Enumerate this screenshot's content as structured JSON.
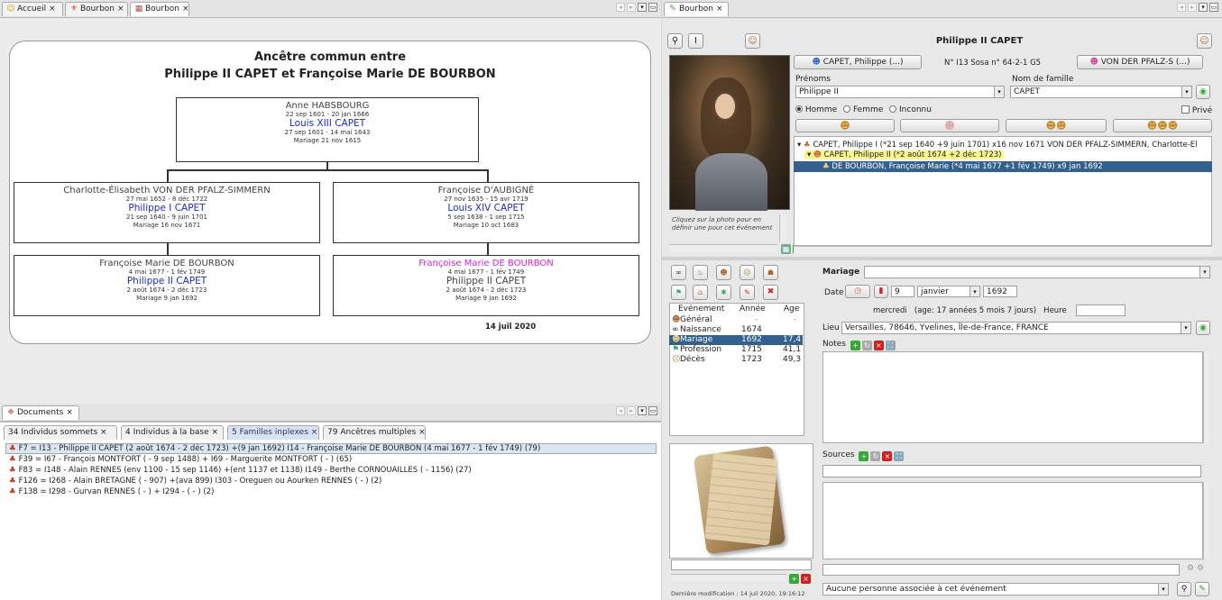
{
  "left_tabs": [
    {
      "label": "Accueil",
      "icon": "☺"
    },
    {
      "label": "Bourbon",
      "icon": "⚜"
    },
    {
      "label": "Bourbon",
      "icon": "▦"
    }
  ],
  "tree": {
    "title_line1": "Ancêtre commun entre",
    "title_line2": "Philippe II CAPET et Françoise Marie DE BOURBON",
    "top": {
      "name": "Anne HABSBOURG",
      "dates": "22 sep 1601 - 20 jan 1666",
      "spouse": "Louis XIII CAPET",
      "spouse_dates": "27 sep 1601 - 14 mai 1643",
      "marriage": "Mariage 21 nov 1615"
    },
    "mid_left": {
      "name": "Charlotte-Élisabeth VON DER PFALZ-SIMMERN",
      "dates": "27 mai 1652 - 8 déc 1722",
      "spouse": "Philippe I CAPET",
      "spouse_dates": "21 sep 1640 - 9 juin 1701",
      "marriage": "Mariage 16 nov 1671"
    },
    "mid_right": {
      "name": "Françoise D'AUBIGNÉ",
      "dates": "27 nov 1635 - 15 avr 1719",
      "spouse": "Louis XIV CAPET",
      "spouse_dates": "5 sep 1638 - 1 sep 1715",
      "marriage": "Mariage 10 oct 1683"
    },
    "bot_left": {
      "name": "Françoise Marie DE BOURBON",
      "dates": "4 mai 1677 - 1 fév 1749",
      "spouse": "Philippe II CAPET",
      "spouse_dates": "2 août 1674 - 2 déc 1723",
      "marriage": "Mariage 9 jan 1692"
    },
    "bot_right": {
      "name": "Françoise Marie DE BOURBON",
      "dates": "4 mai 1677 - 1 fév 1749",
      "spouse": "Philippe II CAPET",
      "spouse_dates": "2 août 1674 - 2 déc 1723",
      "marriage": "Mariage 9 jan 1692"
    },
    "footer_date": "14 juil 2020",
    "highlight_color": "#e020e0"
  },
  "documents": {
    "tab_label": "Documents",
    "subtabs": [
      "34 Individus sommets",
      "4 Individus à la base",
      "5 Familles inplexes",
      "79 Ancêtres multiples"
    ],
    "rows": [
      "F7 = I13 - Philippe II CAPET (2 août 1674 - 2 déc 1723) +(9 jan 1692)  I14 - Françoise Marie DE BOURBON (4 mai 1677 - 1 fév 1749) (79)",
      "F39 = I67 - François MONTFORT ( - 9 sep 1488) + I69 - Marguerite MONTFORT ( - ) (65)",
      "F83 = I148 - Alain RENNES (env 1100 - 15 sep 1146) +(ent 1137 et 1138)  I149 - Berthe CORNOUAILLES ( - 1156) (27)",
      "F126 = I268 - Alain BRETAGNE ( - 907) +(ava 899)  I303 - Oreguen ou Aourken RENNES ( - ) (2)",
      "F138 = I298 - Gurvan RENNES ( - ) + I294 -  ( - ) (2)"
    ]
  },
  "right": {
    "tab_label": "Bourbon",
    "header_name": "Philippe II CAPET",
    "father_btn": "CAPET, Philippe (...)",
    "mother_btn": "VON DER PFALZ-S (...)",
    "id_text": "N° I13  Sosa n° 64-2-1 G5",
    "prenoms_label": "Prénoms",
    "famille_label": "Nom de famille",
    "prenoms_value": "Philippe II",
    "famille_value": "CAPET",
    "sex_options": [
      "Homme",
      "Femme",
      "Inconnu"
    ],
    "prive_label": "Privé",
    "photo_caption": "Cliquez sur la photo pour en définir une pour cet événement",
    "family_tree": [
      "CAPET, Philippe I (*21 sep 1640 +9 juin 1701) x16 nov 1671 VON DER PFALZ-SIMMERN, Charlotte-Él",
      "CAPET, Philippe II (*2 août 1674 +2 déc 1723)",
      "DE BOURBON, Françoise Marie (*4 mai 1677 +1 fév 1749) x9 jan 1692"
    ],
    "events_header": [
      "Evénement",
      "Année",
      "Age"
    ],
    "events": [
      {
        "name": "Général",
        "year": "-",
        "age": "-"
      },
      {
        "name": "Naissance",
        "year": "1674",
        "age": ""
      },
      {
        "name": "Mariage",
        "year": "1692",
        "age": "17,4"
      },
      {
        "name": "Profession",
        "year": "1715",
        "age": "41,1"
      },
      {
        "name": "Décès",
        "year": "1723",
        "age": "49,3"
      }
    ],
    "event_type": "Mariage",
    "date_label": "Date",
    "date_day": "9",
    "date_month": "janvier",
    "date_year": "1692",
    "date_info": "mercredi   (age: 17 années 5 mois 7 jours)   Heure",
    "lieu_label": "Lieu",
    "lieu_value": "Versailles, 78646, Yvelines, Île-de-France, FRANCE",
    "notes_label": "Notes",
    "sources_label": "Sources",
    "last_modif": "Dernière modification : 14 juil 2020, 19:16:12",
    "assoc_value": "Aucune personne associée à cet événement"
  }
}
